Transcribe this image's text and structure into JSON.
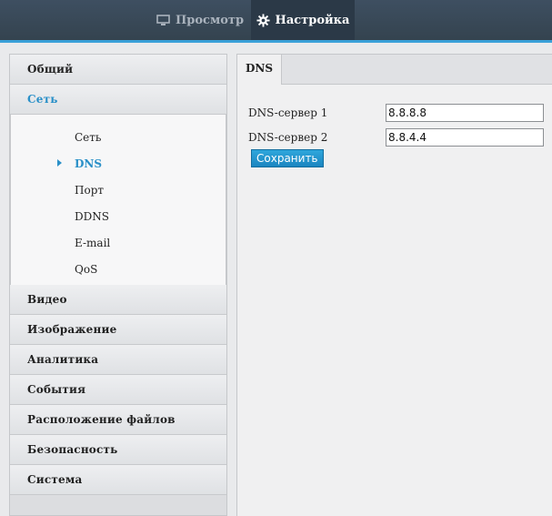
{
  "topnav": {
    "view_label": "Просмотр",
    "view_icon": "monitor-icon",
    "settings_label": "Настройка",
    "settings_icon": "gear-icon"
  },
  "sidebar": {
    "sections": [
      {
        "label": "Общий"
      },
      {
        "label": "Сеть",
        "active": true
      },
      {
        "label": "Видео"
      },
      {
        "label": "Изображение"
      },
      {
        "label": "Аналитика"
      },
      {
        "label": "События"
      },
      {
        "label": "Расположение файлов"
      },
      {
        "label": "Безопасность"
      },
      {
        "label": "Система"
      }
    ],
    "network_items": [
      {
        "label": "Сеть"
      },
      {
        "label": "DNS",
        "active": true
      },
      {
        "label": "Порт"
      },
      {
        "label": "DDNS"
      },
      {
        "label": "E-mail"
      },
      {
        "label": "QoS"
      }
    ]
  },
  "content": {
    "tab_label": "DNS",
    "dns1_label": "DNS-сервер 1",
    "dns1_value": "8.8.8.8",
    "dns2_label": "DNS-сервер 2",
    "dns2_value": "8.8.4.4",
    "save_label": "Сохранить"
  },
  "colors": {
    "accent": "#2a90c8",
    "topbar": "#3a4a5b",
    "button": "#1f8fca"
  }
}
